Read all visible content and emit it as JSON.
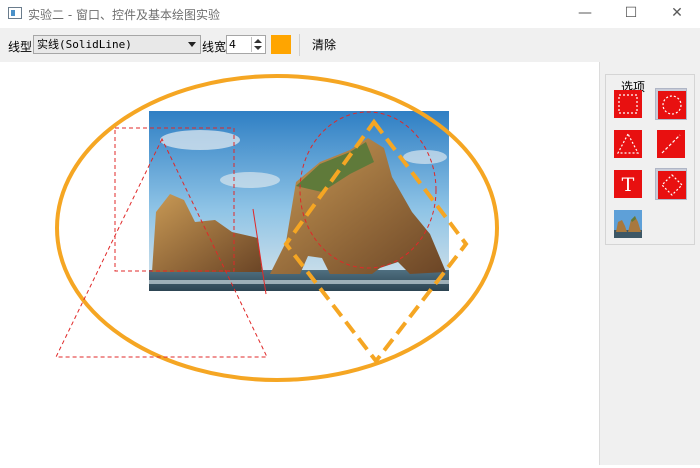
{
  "window": {
    "title": "实验二 - 窗口、控件及基本绘图实验",
    "minimize_glyph": "—",
    "maximize_glyph": "☐",
    "close_glyph": "✕"
  },
  "toolbar": {
    "line_type_label": "线型",
    "line_type_value": "实线(SolidLine)",
    "line_width_label": "线宽",
    "line_width_value": "4",
    "pen_color": "#ffa500",
    "clear_label": "清除"
  },
  "sidebar": {
    "group_title": "选项",
    "tools": [
      {
        "name": "rectangle",
        "icon": "dashed-rectangle-icon",
        "checked": false
      },
      {
        "name": "ellipse",
        "icon": "dashed-circle-icon",
        "checked": true
      },
      {
        "name": "triangle",
        "icon": "dashed-triangle-icon",
        "checked": false
      },
      {
        "name": "line",
        "icon": "dashed-line-icon",
        "checked": false
      },
      {
        "name": "text",
        "icon": "text-icon",
        "label": "T",
        "checked": false
      },
      {
        "name": "diamond",
        "icon": "dashed-diamond-icon",
        "checked": true
      },
      {
        "name": "image",
        "icon": "image-icon",
        "checked": false
      }
    ]
  },
  "colors": {
    "tool_red": "#e81010",
    "shape_red": "#e02828",
    "orange": "#f5a623"
  }
}
